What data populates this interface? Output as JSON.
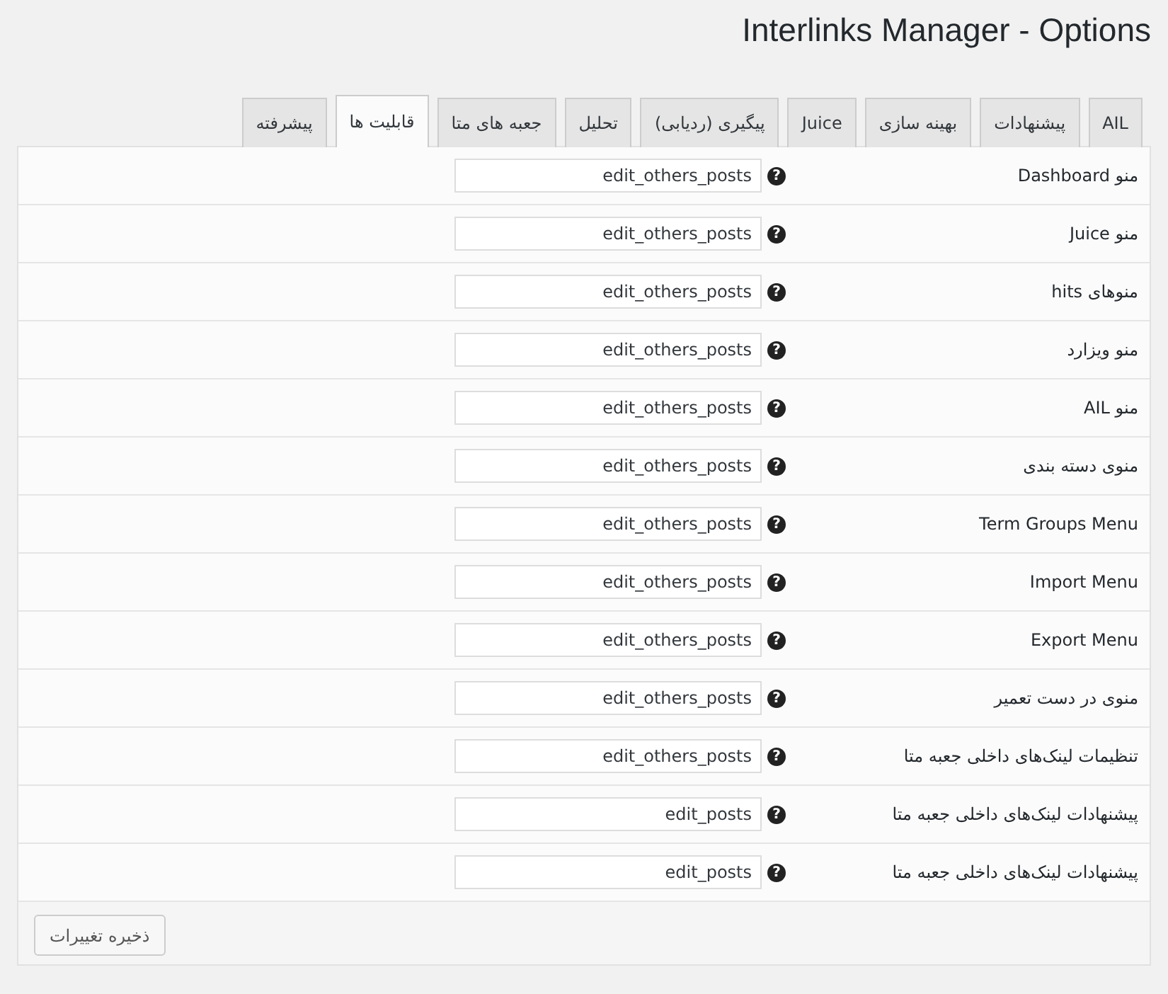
{
  "page_title": "Interlinks Manager - Options",
  "tabs": [
    {
      "label": "AIL",
      "selected": false
    },
    {
      "label": "پیشنهادات",
      "selected": false
    },
    {
      "label": "بهینه سازی",
      "selected": false
    },
    {
      "label": "Juice",
      "selected": false
    },
    {
      "label": "پیگیری (ردیابی)",
      "selected": false
    },
    {
      "label": "تحلیل",
      "selected": false
    },
    {
      "label": "جعبه های متا",
      "selected": false
    },
    {
      "label": "قابلیت ها",
      "selected": true
    },
    {
      "label": "پیشرفته",
      "selected": false
    }
  ],
  "settings": [
    {
      "label": "منو Dashboard",
      "value": "edit_others_posts",
      "help_icon": "?"
    },
    {
      "label": "منو Juice",
      "value": "edit_others_posts",
      "help_icon": "?"
    },
    {
      "label": "منوهای hits",
      "value": "edit_others_posts",
      "help_icon": "?"
    },
    {
      "label": "منو ویزارد",
      "value": "edit_others_posts",
      "help_icon": "?"
    },
    {
      "label": "منو AIL",
      "value": "edit_others_posts",
      "help_icon": "?"
    },
    {
      "label": "منوی دسته بندی",
      "value": "edit_others_posts",
      "help_icon": "?"
    },
    {
      "label": "Term Groups Menu",
      "value": "edit_others_posts",
      "help_icon": "?"
    },
    {
      "label": "Import Menu",
      "value": "edit_others_posts",
      "help_icon": "?"
    },
    {
      "label": "Export Menu",
      "value": "edit_others_posts",
      "help_icon": "?"
    },
    {
      "label": "منوی در دست تعمیر",
      "value": "edit_others_posts",
      "help_icon": "?"
    },
    {
      "label": "تنظیمات لینک‌های داخلی جعبه متا",
      "value": "edit_others_posts",
      "help_icon": "?"
    },
    {
      "label": "پیشنهادات لینک‌های داخلی جعبه متا",
      "value": "edit_posts",
      "help_icon": "?"
    },
    {
      "label": "پیشنهادات لینک‌های داخلی جعبه متا",
      "value": "edit_posts",
      "help_icon": "?"
    }
  ],
  "save_button": "ذخیره تغییرات"
}
